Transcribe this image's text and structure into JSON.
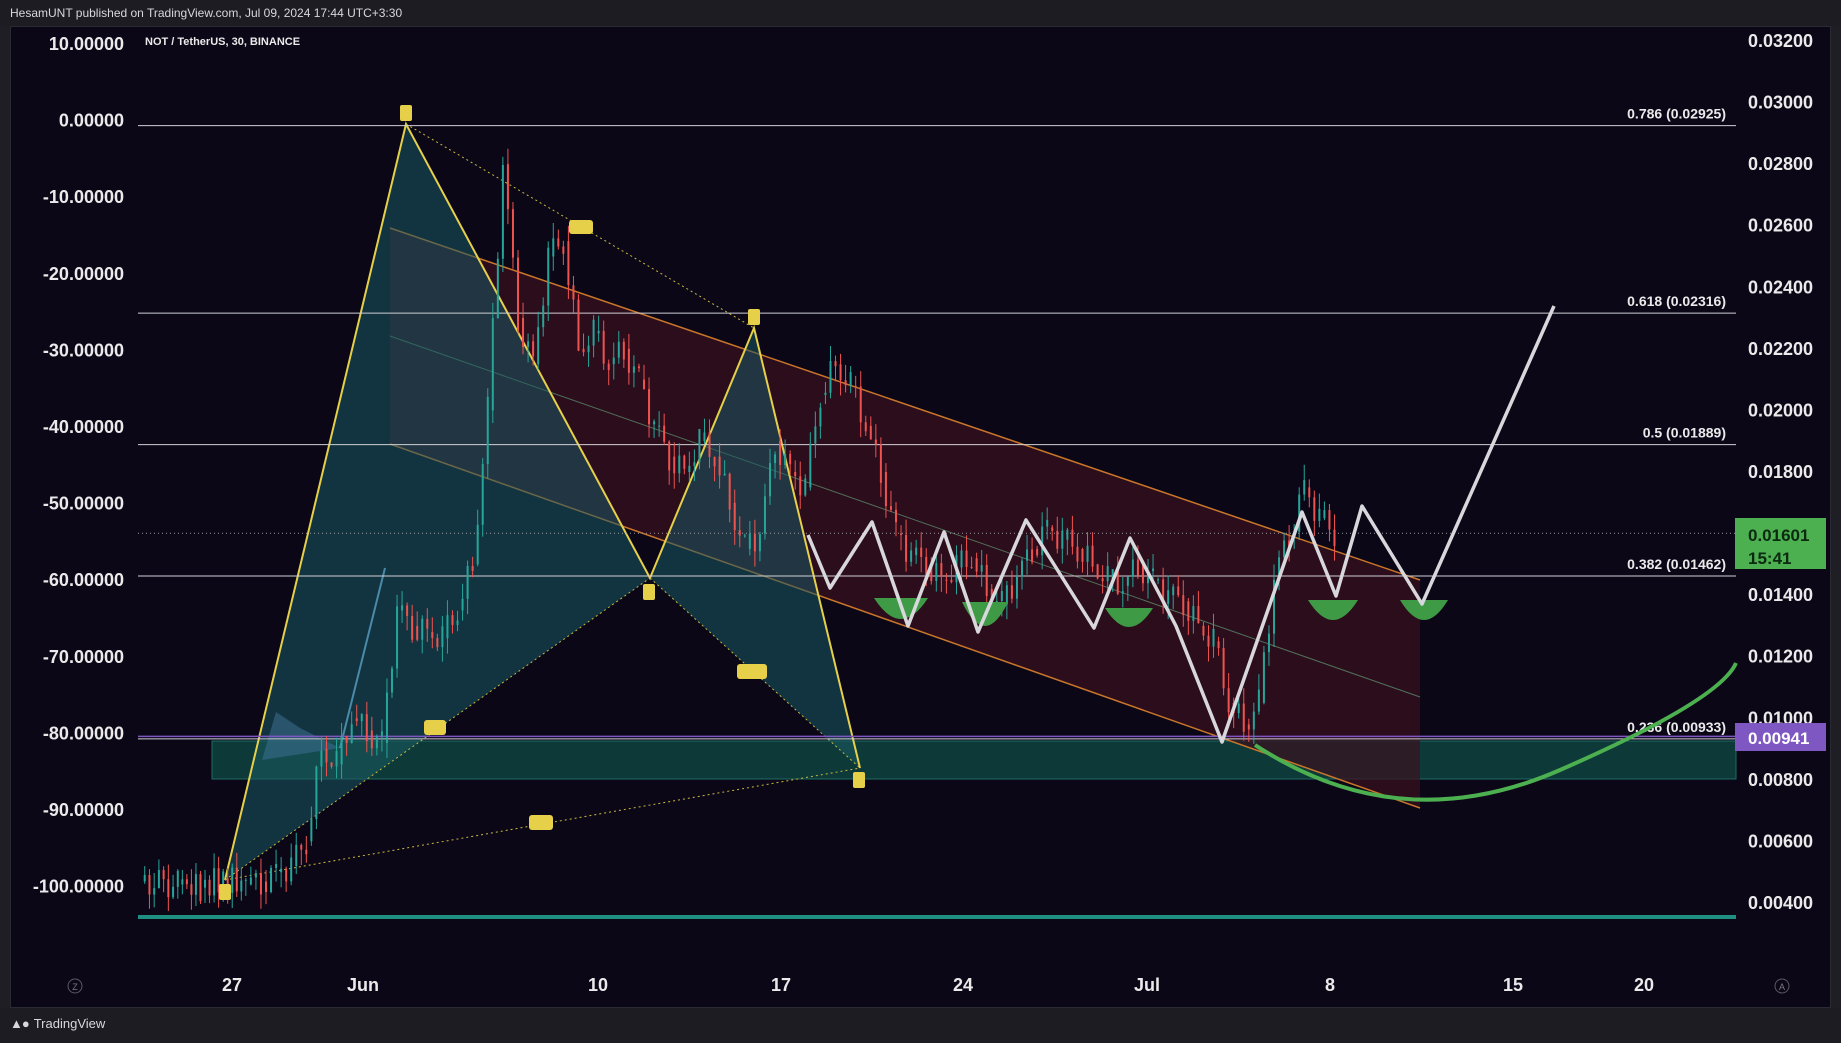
{
  "header": {
    "published": "HesamUNT published on TradingView.com, Jul 09, 2024 17:44 UTC+3:30"
  },
  "chart_data": {
    "type": "candlestick",
    "title": "NOT / TetherUS, 30, BINANCE",
    "y_left_ticks": [
      "10.00000",
      "0.00000",
      "-10.00000",
      "-20.00000",
      "-30.00000",
      "-40.00000",
      "-50.00000",
      "-60.00000",
      "-70.00000",
      "-80.00000",
      "-90.00000",
      "-100.00000"
    ],
    "y_right_ticks": [
      "0.03200",
      "0.03000",
      "0.02800",
      "0.02600",
      "0.02400",
      "0.02200",
      "0.02000",
      "0.01800",
      "0.01400",
      "0.01200",
      "0.01000",
      "0.00800",
      "0.00600",
      "0.00400"
    ],
    "ylim": [
      0.0032,
      0.0326
    ],
    "x_ticks": [
      "27",
      "Jun",
      "10",
      "17",
      "24",
      "Jul",
      "8",
      "15",
      "20"
    ],
    "fib_levels": [
      {
        "ratio": "0.786",
        "price": 0.02925,
        "label": "0.786 (0.02925)"
      },
      {
        "ratio": "0.618",
        "price": 0.02316,
        "label": "0.618 (0.02316)"
      },
      {
        "ratio": "0.5",
        "price": 0.01889,
        "label": "0.5 (0.01889)"
      },
      {
        "ratio": "0.382",
        "price": 0.01462,
        "label": "0.382 (0.01462)"
      },
      {
        "ratio": "0.236",
        "price": 0.00933,
        "label": "0.236 (0.00933)"
      }
    ],
    "current_price": {
      "value": "0.01601",
      "countdown": "15:41",
      "color": "#4caf50"
    },
    "marked_price": {
      "value": "0.00941",
      "color": "#7e57c2"
    },
    "price_path": [
      [
        0,
        0.0047
      ],
      [
        5,
        0.0046
      ],
      [
        8,
        0.0045
      ],
      [
        11,
        0.0048
      ],
      [
        14,
        0.0046
      ],
      [
        16,
        0.0047
      ],
      [
        18,
        0.005
      ],
      [
        20,
        0.0052
      ],
      [
        22,
        0.006
      ],
      [
        24,
        0.009
      ],
      [
        26,
        0.0085
      ],
      [
        28,
        0.01
      ],
      [
        30,
        0.0096
      ],
      [
        32,
        0.0092
      ],
      [
        34,
        0.0135
      ],
      [
        36,
        0.013
      ],
      [
        38,
        0.0128
      ],
      [
        40,
        0.0126
      ],
      [
        42,
        0.0135
      ],
      [
        44,
        0.015
      ],
      [
        46,
        0.02
      ],
      [
        48,
        0.028
      ],
      [
        50,
        0.023
      ],
      [
        52,
        0.0215
      ],
      [
        54,
        0.025
      ],
      [
        56,
        0.0255
      ],
      [
        58,
        0.022
      ],
      [
        60,
        0.0225
      ],
      [
        62,
        0.0215
      ],
      [
        64,
        0.022
      ],
      [
        66,
        0.021
      ],
      [
        68,
        0.0195
      ],
      [
        70,
        0.0185
      ],
      [
        72,
        0.018
      ],
      [
        74,
        0.019
      ],
      [
        76,
        0.0185
      ],
      [
        78,
        0.017
      ],
      [
        80,
        0.0155
      ],
      [
        82,
        0.016
      ],
      [
        84,
        0.019
      ],
      [
        86,
        0.018
      ],
      [
        88,
        0.0175
      ],
      [
        90,
        0.0205
      ],
      [
        92,
        0.0215
      ],
      [
        94,
        0.0208
      ],
      [
        96,
        0.0195
      ],
      [
        98,
        0.018
      ],
      [
        100,
        0.016
      ],
      [
        102,
        0.0153
      ],
      [
        104,
        0.015
      ],
      [
        106,
        0.0145
      ],
      [
        108,
        0.0149
      ],
      [
        110,
        0.0152
      ],
      [
        112,
        0.0142
      ],
      [
        114,
        0.0137
      ],
      [
        116,
        0.0146
      ],
      [
        118,
        0.0155
      ],
      [
        120,
        0.0162
      ],
      [
        122,
        0.0158
      ],
      [
        124,
        0.0155
      ],
      [
        126,
        0.015
      ],
      [
        128,
        0.0145
      ],
      [
        130,
        0.0143
      ],
      [
        132,
        0.015
      ],
      [
        134,
        0.0145
      ],
      [
        136,
        0.014
      ],
      [
        138,
        0.0138
      ],
      [
        140,
        0.013
      ],
      [
        142,
        0.0125
      ],
      [
        144,
        0.0105
      ],
      [
        146,
        0.0098
      ],
      [
        148,
        0.0105
      ],
      [
        150,
        0.0145
      ],
      [
        152,
        0.016
      ],
      [
        154,
        0.0175
      ],
      [
        156,
        0.0165
      ],
      [
        158,
        0.016
      ]
    ],
    "legend": "none"
  }
}
